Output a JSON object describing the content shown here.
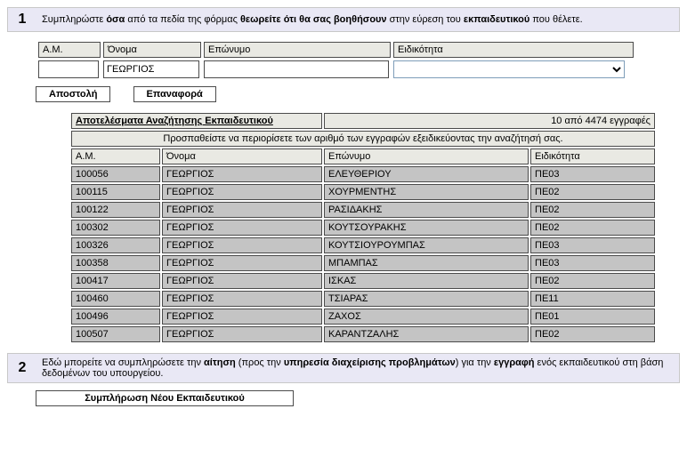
{
  "section1": {
    "num": "1",
    "text_parts": [
      "Συμπληρώστε ",
      "όσα",
      " από τα πεδία της φόρμας ",
      "θεωρείτε ότι θα σας βοηθήσουν",
      " στην εύρεση του ",
      "εκπαιδευτικού",
      " που θέλετε."
    ]
  },
  "form": {
    "headers": {
      "am": "Α.Μ.",
      "name": "Όνομα",
      "surname": "Επώνυμο",
      "spec": "Ειδικότητα"
    },
    "values": {
      "am": "",
      "name": "ΓΕΩΡΓΙΟΣ",
      "surname": "",
      "spec": ""
    },
    "buttons": {
      "submit": "Αποστολή",
      "reset": "Επαναφορά"
    }
  },
  "results": {
    "title": "Αποτελέσματα Αναζήτησης Εκπαιδευτικού",
    "count_text": "10 από 4474 εγγραφές",
    "hint": "Προσπαθείστε να περιορίσετε των αριθμό των εγγραφών εξειδικεύοντας την αναζήτησή σας.",
    "columns": {
      "am": "Α.Μ.",
      "name": "Όνομα",
      "surname": "Επώνυμο",
      "spec": "Ειδικότητα"
    },
    "rows": [
      {
        "am": "100056",
        "name": "ΓΕΩΡΓΙΟΣ",
        "surname": "ΕΛΕΥΘΕΡΙΟΥ",
        "spec": "ΠΕ03"
      },
      {
        "am": "100115",
        "name": "ΓΕΩΡΓΙΟΣ",
        "surname": "ΧΟΥΡΜΕΝΤΗΣ",
        "spec": "ΠΕ02"
      },
      {
        "am": "100122",
        "name": "ΓΕΩΡΓΙΟΣ",
        "surname": "ΡΑΣΙΔΑΚΗΣ",
        "spec": "ΠΕ02"
      },
      {
        "am": "100302",
        "name": "ΓΕΩΡΓΙΟΣ",
        "surname": "ΚΟΥΤΣΟΥΡΑΚΗΣ",
        "spec": "ΠΕ02"
      },
      {
        "am": "100326",
        "name": "ΓΕΩΡΓΙΟΣ",
        "surname": "ΚΟΥΤΣΙΟΥΡΟΥΜΠΑΣ",
        "spec": "ΠΕ03"
      },
      {
        "am": "100358",
        "name": "ΓΕΩΡΓΙΟΣ",
        "surname": "ΜΠΑΜΠΑΣ",
        "spec": "ΠΕ03"
      },
      {
        "am": "100417",
        "name": "ΓΕΩΡΓΙΟΣ",
        "surname": "ΙΣΚΑΣ",
        "spec": "ΠΕ02"
      },
      {
        "am": "100460",
        "name": "ΓΕΩΡΓΙΟΣ",
        "surname": "ΤΣΙΑΡΑΣ",
        "spec": "ΠΕ11"
      },
      {
        "am": "100496",
        "name": "ΓΕΩΡΓΙΟΣ",
        "surname": "ΖΑΧΟΣ",
        "spec": "ΠΕ01"
      },
      {
        "am": "100507",
        "name": "ΓΕΩΡΓΙΟΣ",
        "surname": "ΚΑΡΑΝΤΖΑΛΗΣ",
        "spec": "ΠΕ02"
      }
    ]
  },
  "section2": {
    "num": "2",
    "text_parts": [
      "Εδώ μπορείτε να συμπληρώσετε την ",
      "αίτηση",
      " (προς την ",
      "υπηρεσία διαχείρισης προβλημάτων",
      ") για την ",
      "εγγραφή",
      " ενός εκπαιδευτικού στη βάση δεδομένων του υπουργείου."
    ],
    "button": "Συμπλήρωση Νέου Εκπαιδευτικού"
  }
}
